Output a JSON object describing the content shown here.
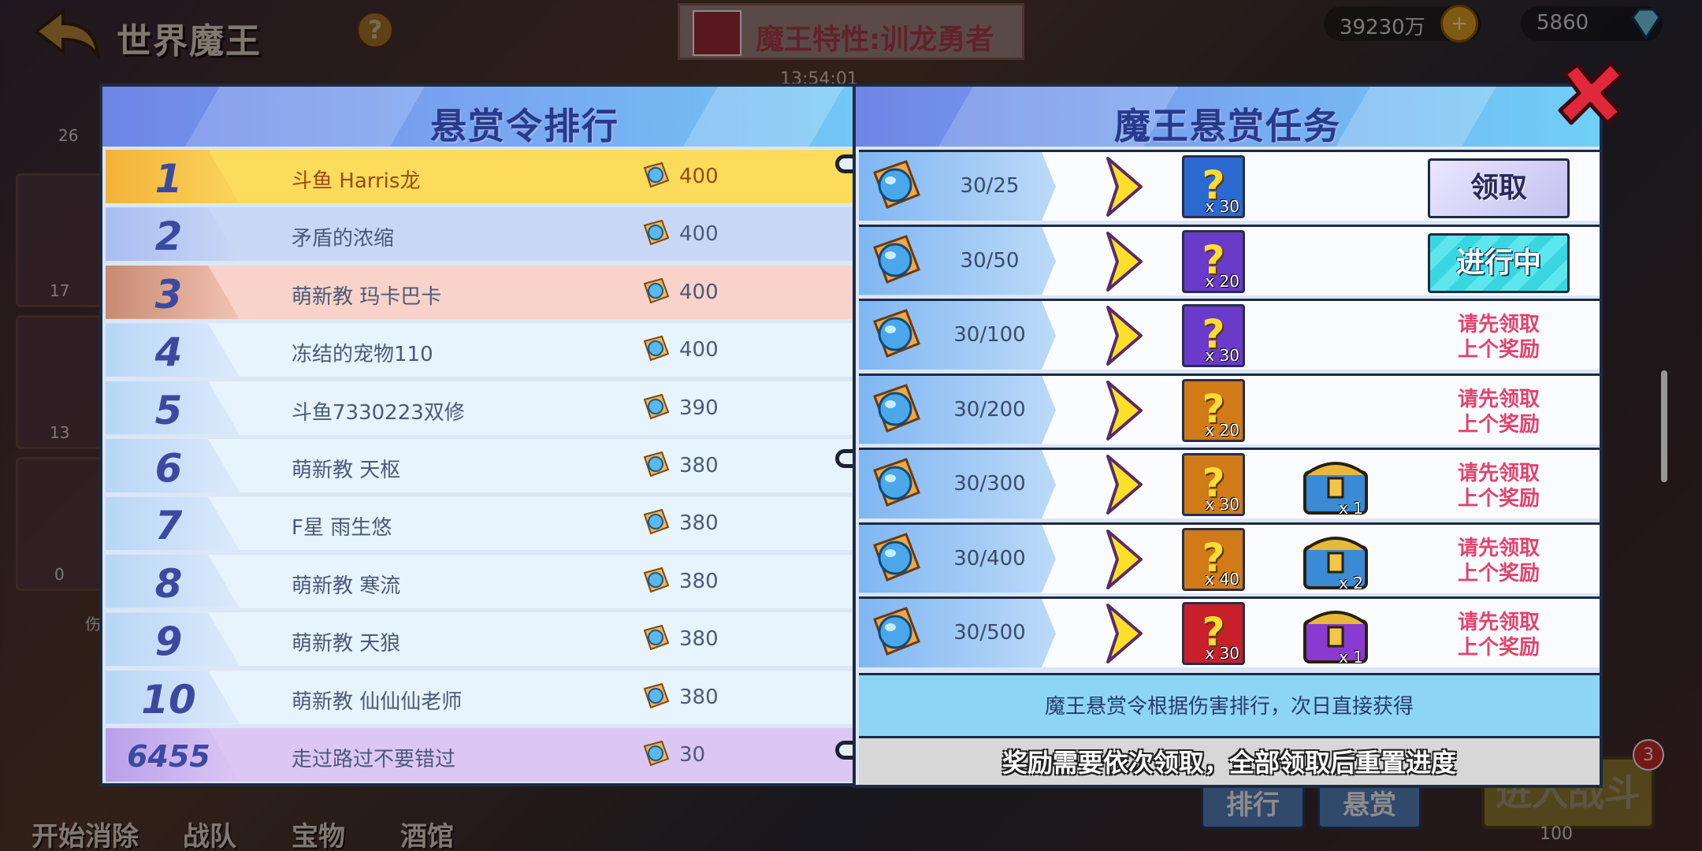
{
  "hud": {
    "page_title": "世界魔王",
    "help_label": "?",
    "boss_trait": "魔王特性:训龙勇者",
    "timer": "13:54:01",
    "gold": "39230万",
    "gems": "5860",
    "plus": "+",
    "left_strip": {
      "top": "26",
      "counts": [
        "17",
        "13",
        "0"
      ],
      "partial": "伤"
    },
    "bottom_buttons": [
      "开始消除",
      "战队",
      "宝物",
      "酒馆"
    ],
    "tabs": [
      "排行",
      "悬赏"
    ],
    "enter_battle": "进入战斗",
    "battle_badge": "3",
    "battle_cost": "100"
  },
  "ranking": {
    "title": "悬赏令排行",
    "rows": [
      {
        "rank": "1",
        "name": "斗鱼  Harris龙",
        "score": "400"
      },
      {
        "rank": "2",
        "name": "矛盾的浓缩",
        "score": "400"
      },
      {
        "rank": "3",
        "name": "萌新教 玛卡巴卡",
        "score": "400"
      },
      {
        "rank": "4",
        "name": "冻结的宠物110",
        "score": "400"
      },
      {
        "rank": "5",
        "name": "斗鱼7330223双修",
        "score": "390"
      },
      {
        "rank": "6",
        "name": "萌新教 天枢",
        "score": "380"
      },
      {
        "rank": "7",
        "name": "F星 雨生悠",
        "score": "380"
      },
      {
        "rank": "8",
        "name": "萌新教  寒流",
        "score": "380"
      },
      {
        "rank": "9",
        "name": "萌新教 天狼",
        "score": "380"
      },
      {
        "rank": "10",
        "name": "萌新教 仙仙仙老师",
        "score": "380"
      }
    ],
    "self": {
      "rank": "6455",
      "name": "走过路过不要错过",
      "score": "30"
    }
  },
  "tasks": {
    "title": "魔王悬赏任务",
    "rows": [
      {
        "progress": "30/25",
        "box_color": "#2a6ad0",
        "box_qty": "x 30",
        "chest": null,
        "status": "claim"
      },
      {
        "progress": "30/50",
        "box_color": "#6a3ac8",
        "box_qty": "x 20",
        "chest": null,
        "status": "in_progress"
      },
      {
        "progress": "30/100",
        "box_color": "#6a3ac8",
        "box_qty": "x 30",
        "chest": null,
        "status": "locked"
      },
      {
        "progress": "30/200",
        "box_color": "#d07a18",
        "box_qty": "x 20",
        "chest": null,
        "status": "locked"
      },
      {
        "progress": "30/300",
        "box_color": "#d07a18",
        "box_qty": "x 30",
        "chest": {
          "color": "#3a8ad6",
          "qty": "x 1"
        },
        "status": "locked"
      },
      {
        "progress": "30/400",
        "box_color": "#d07a18",
        "box_qty": "x 40",
        "chest": {
          "color": "#3a8ad6",
          "qty": "x 2"
        },
        "status": "locked"
      },
      {
        "progress": "30/500",
        "box_color": "#c8202a",
        "box_qty": "x 30",
        "chest": {
          "color": "#8a3ad0",
          "qty": "x 1"
        },
        "status": "locked"
      }
    ],
    "claim_label": "领取",
    "in_progress_label": "进行中",
    "locked_line1": "请先领取",
    "locked_line2": "上个奖励",
    "note": "魔王悬赏令根据伤害排行，次日直接获得",
    "footer": "奖励需要依次领取，全部领取后重置进度"
  },
  "colors": {
    "rank1": "#fddc5c",
    "rank2": "#c9d7f6",
    "rank3": "#f9d3c9",
    "rank_default": "#e7f3fd",
    "self_row": "#dcc6f4",
    "header_gradient_start": "#6e86e6",
    "header_gradient_end": "#6fd0f6",
    "locked_text": "#e2436a",
    "rank1_name": "#9a4a10"
  }
}
